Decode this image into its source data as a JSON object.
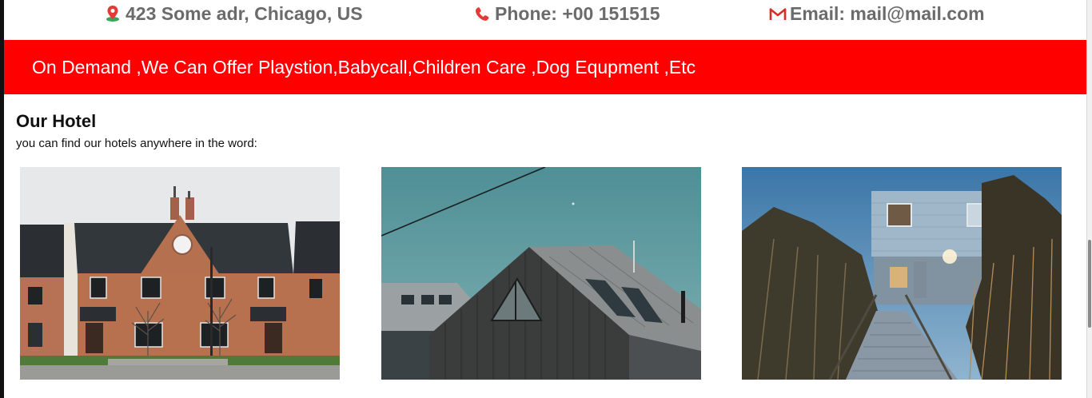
{
  "contact": {
    "address": "423 Some adr, Chicago, US",
    "phone": "Phone: +00 151515",
    "email": "Email: mail@mail.com",
    "icons": [
      "map-pin-icon",
      "phone-icon",
      "gmail-icon"
    ]
  },
  "banner": {
    "text": "On Demand ,We Can Offer Playstion,Babycall,Children Care ,Dog Equpment ,Etc",
    "background": "#ff0000"
  },
  "hotels": {
    "title": "Our Hotel",
    "subtitle": "you can find our hotels anywhere in the word:",
    "images": [
      "brick-houses-photo",
      "dark-wooden-house-photo",
      "coastal-house-boardwalk-photo"
    ]
  }
}
